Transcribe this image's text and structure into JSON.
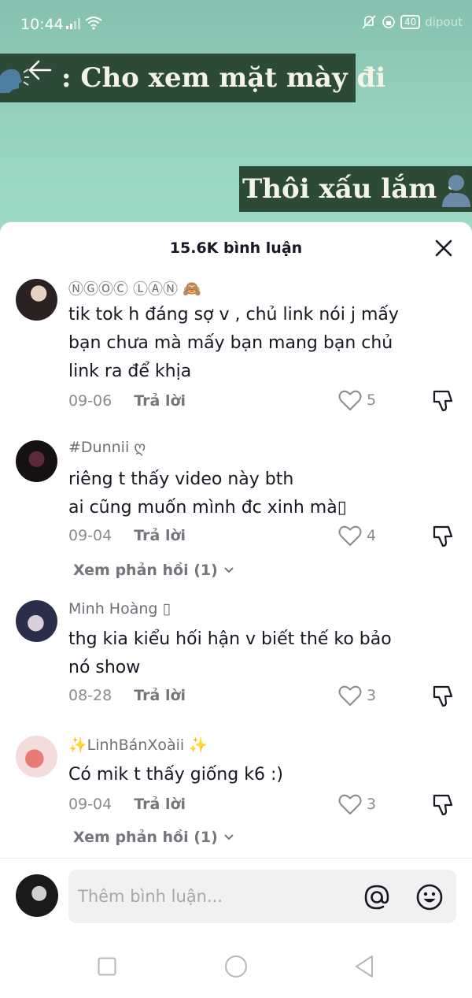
{
  "status_bar": {
    "time": "10:44",
    "battery": "40",
    "watermark": "dipout"
  },
  "video": {
    "caption_1": ": Cho xem mặt mày đi",
    "caption_2": "Thôi xấu lắm :"
  },
  "comments_sheet": {
    "count_label": "15.6K bình luận",
    "reply_label": "Trả lời",
    "comments": [
      {
        "username": "ⓃⒼⓄⒸ ⓁⒶⓃ 🙈",
        "text": "tik tok h đáng sợ v , chủ link nói j mấy bạn chưa mà mấy bạn mang bạn chủ link ra để khịa",
        "date": "09-06",
        "likes": "5",
        "view_replies": ""
      },
      {
        "username": "#Dunnii ღ",
        "text": "riêng t thấy video này bth\nai cũng muốn mình đc xinh mà▯",
        "date": "09-04",
        "likes": "4",
        "view_replies": "Xem phản hồi (1)"
      },
      {
        "username": "Minh Hoàng ▯",
        "text": "thg kia kiểu hối hận v biết thế ko bảo nó show",
        "date": "08-28",
        "likes": "3",
        "view_replies": ""
      },
      {
        "username": "✨LinhBánXoàii ✨",
        "text": "Có mik t thấy giống k6 :)",
        "date": "09-04",
        "likes": "3",
        "view_replies": "Xem phản hồi (1)"
      }
    ]
  },
  "input": {
    "placeholder": "Thêm bình luận..."
  },
  "colors": {
    "caption_bg": "#2d4a37",
    "video_bg": "#94d1bd",
    "text_primary": "#161823",
    "text_secondary": "#8a8b91"
  },
  "icons": [
    "back-arrow-icon",
    "speaker-emoji",
    "person-silhouette-emoji",
    "close-icon",
    "heart-icon",
    "dislike-icon",
    "chevron-down-icon",
    "at-icon",
    "emoji-icon",
    "nav-square-icon",
    "nav-circle-icon",
    "nav-back-icon"
  ]
}
